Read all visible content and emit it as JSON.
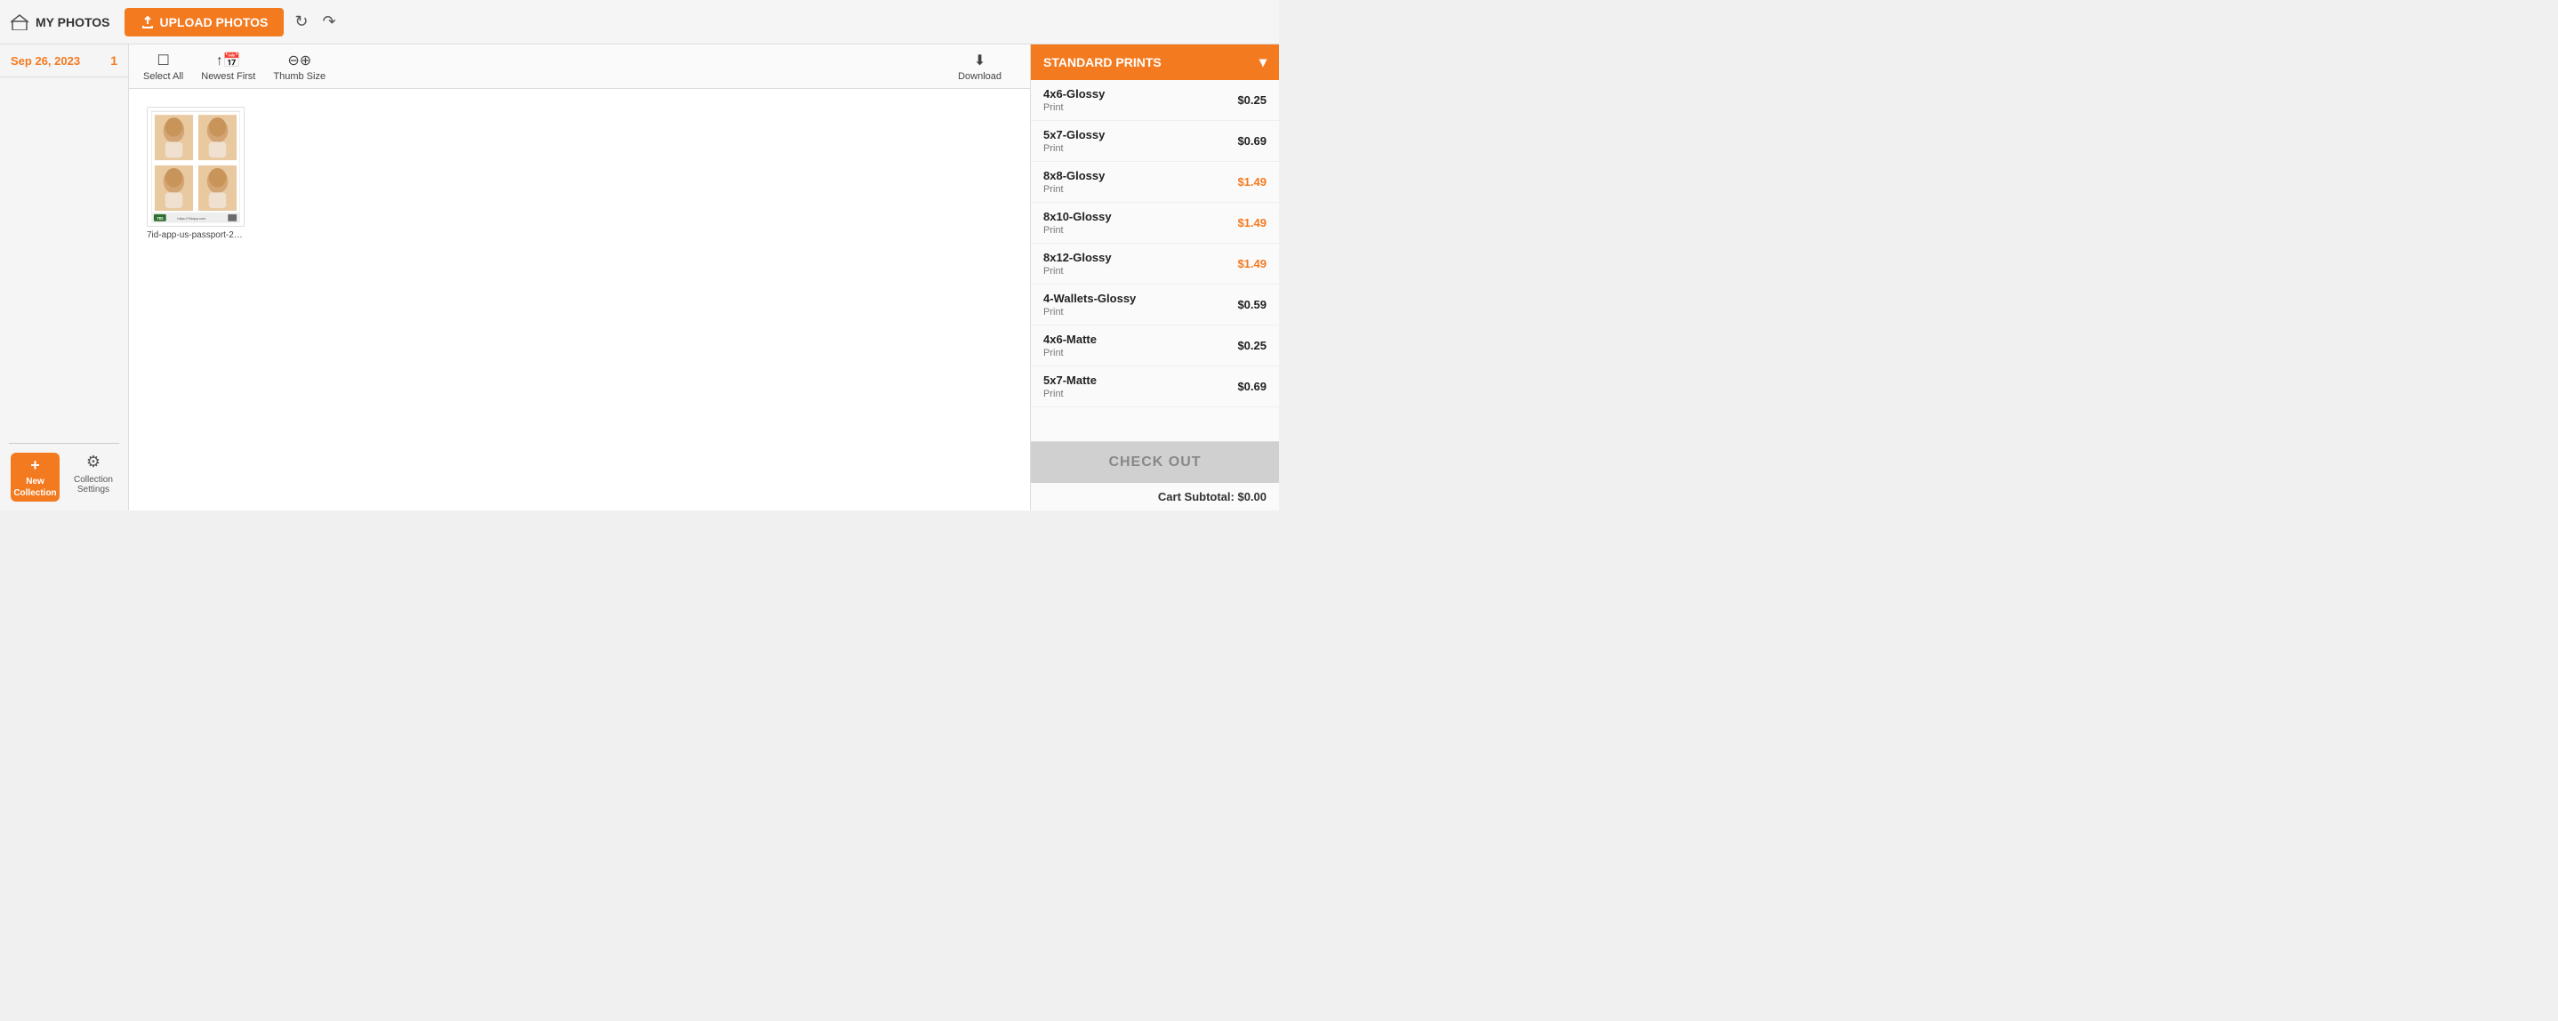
{
  "topbar": {
    "my_photos_label": "MY PHOTOS",
    "upload_label": "UPLOAD PHOTOS",
    "refresh_icon": "↻",
    "reply_icon": "↷"
  },
  "sidebar": {
    "date_label": "Sep 26, 2023",
    "count": "1",
    "new_collection_label": "New\nCollection",
    "collection_settings_label": "Collection\nSettings"
  },
  "toolbar": {
    "select_all_label": "Select All",
    "newest_first_label": "Newest First",
    "thumb_size_label": "Thumb Size",
    "download_label": "Download"
  },
  "photos": [
    {
      "filename": "7id-app-us-passport-2023-09-..."
    }
  ],
  "prints_panel": {
    "header_label": "STANDARD PRINTS",
    "items": [
      {
        "name": "4x6-Glossy",
        "sub": "Print",
        "price": "$0.25",
        "highlighted": false
      },
      {
        "name": "5x7-Glossy",
        "sub": "Print",
        "price": "$0.69",
        "highlighted": false
      },
      {
        "name": "8x8-Glossy",
        "sub": "Print",
        "price": "$1.49",
        "highlighted": true
      },
      {
        "name": "8x10-Glossy",
        "sub": "Print",
        "price": "$1.49",
        "highlighted": true
      },
      {
        "name": "8x12-Glossy",
        "sub": "Print",
        "price": "$1.49",
        "highlighted": true
      },
      {
        "name": "4-Wallets-Glossy",
        "sub": "Print",
        "price": "$0.59",
        "highlighted": false
      },
      {
        "name": "4x6-Matte",
        "sub": "Print",
        "price": "$0.25",
        "highlighted": false
      },
      {
        "name": "5x7-Matte",
        "sub": "Print",
        "price": "$0.69",
        "highlighted": false
      }
    ],
    "checkout_label": "CHECK OUT",
    "cart_subtotal_label": "Cart Subtotal: $0.00"
  }
}
